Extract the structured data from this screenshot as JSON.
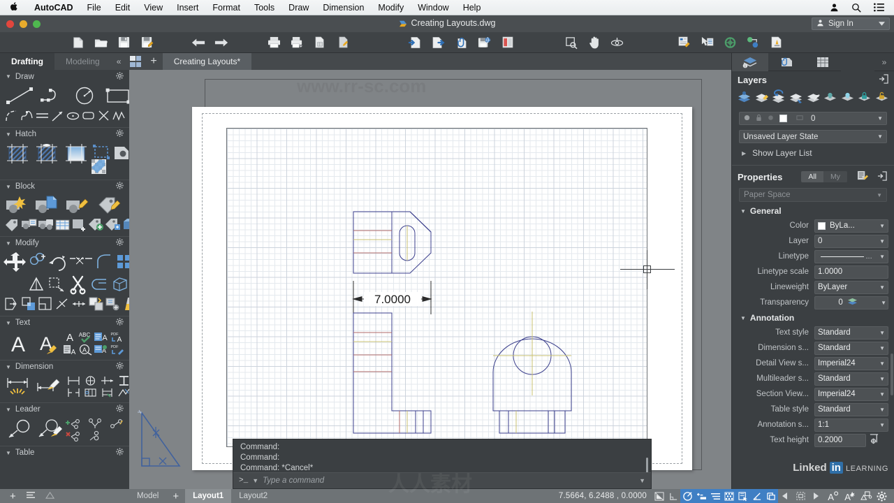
{
  "menubar": {
    "apple_icon": "apple-icon",
    "items": [
      {
        "label": "AutoCAD",
        "bold": true
      },
      {
        "label": "File"
      },
      {
        "label": "Edit"
      },
      {
        "label": "View"
      },
      {
        "label": "Insert"
      },
      {
        "label": "Format"
      },
      {
        "label": "Tools"
      },
      {
        "label": "Draw"
      },
      {
        "label": "Dimension"
      },
      {
        "label": "Modify"
      },
      {
        "label": "Window"
      },
      {
        "label": "Help"
      }
    ],
    "right_icons": [
      "user-icon",
      "search-icon",
      "list-icon"
    ]
  },
  "titlebar": {
    "document_title": "Creating Layouts.dwg",
    "sign_in_label": "Sign In"
  },
  "toolbar": {
    "groups": [
      [
        "new-file-icon",
        "open-folder-icon",
        "save-icon",
        "save-as-icon"
      ],
      [
        "undo-icon",
        "redo-icon"
      ],
      [
        "print-icon",
        "plot-icon",
        "page-setup-icon",
        "plot-preview-icon"
      ],
      [
        "import-icon",
        "export-icon",
        "attach-icon",
        "publish-web-icon",
        "reference-manager-icon"
      ],
      [
        "zoom-window-icon",
        "pan-icon",
        "orbit-icon"
      ],
      [
        "properties-icon",
        "quick-select-icon",
        "measure-icon",
        "point-filter-icon",
        "tool-palette-icon"
      ]
    ]
  },
  "workspace_bar": {
    "tabs": [
      {
        "label": "Drafting",
        "active": true
      },
      {
        "label": "Modeling",
        "active": false
      }
    ],
    "collapse_icon": "chevron-double-left-icon",
    "layout_grid_icon": "layout-grid-icon",
    "new_tab_icon": "plus-icon",
    "document_tab": "Creating Layouts*"
  },
  "left_palette": {
    "groups": [
      {
        "title": "Draw",
        "gear_icon": "gear-icon",
        "tools_row1": [
          "line-icon",
          "polyline-icon",
          "circle-icon",
          "rectangle-icon"
        ],
        "tools_row2": [
          "arc-icon",
          "spline-icon",
          "multiline-icon",
          "ray-icon",
          "ellipse-icon",
          "polygon-icon",
          "construction-line-icon",
          "revision-cloud-icon"
        ]
      },
      {
        "title": "Hatch",
        "gear_icon": "gear-icon",
        "tools_row1": [
          "hatch-icon",
          "hatch-edit-icon",
          "gradient-icon",
          "boundary-icon",
          "wipeout-icon"
        ],
        "tools_row2": [
          "hatch-transparency-icon"
        ]
      },
      {
        "title": "Block",
        "gear_icon": "gear-icon",
        "tools_row1": [
          "insert-block-icon",
          "block-editor-icon",
          "edit-block-icon",
          "define-attribute-icon"
        ],
        "tools_row2": [
          "attribute-icon",
          "block-attributes-icon",
          "sync-attributes-icon",
          "block-table-icon",
          "create-block-icon",
          "block-palette-icon",
          "block-library-icon",
          "base-point-icon"
        ]
      },
      {
        "title": "Modify",
        "gear_icon": "gear-icon",
        "tools_row1": [
          "move-icon",
          "copy-icon",
          "rotate-icon",
          "trim-icon",
          "fillet-icon",
          "array-icon"
        ],
        "tools_row2": [
          "mirror-icon",
          "stretch-icon",
          "scissors-icon",
          "join-icon",
          "3d-solid-icon"
        ],
        "tools_row3": [
          "offset-icon",
          "scale-icon",
          "extend-icon",
          "break-icon",
          "lengthen-icon",
          "explode-icon",
          "edit-polyline-icon",
          "erase-sweep-icon"
        ]
      },
      {
        "title": "Text",
        "gear_icon": "gear-icon",
        "tools_row1": [
          "single-text-icon",
          "text-style-icon",
          "text-edit-icon",
          "spell-check-icon",
          "mtext-icon",
          "pdf-text-icon"
        ],
        "tools_row2": [
          "text-align-icon",
          "find-text-icon",
          "text-scale-icon",
          "pdf-import-icon"
        ]
      },
      {
        "title": "Dimension",
        "gear_icon": "gear-icon",
        "tools_row1": [
          "dimension-icon",
          "dimension-style-icon",
          "baseline-dim-icon",
          "center-mark-icon",
          "continue-dim-icon",
          "tolerance-icon"
        ],
        "tools_row2": [
          "dim-break-icon",
          "dim-inspect-icon",
          "dim-space-icon",
          "dim-jog-icon"
        ]
      },
      {
        "title": "Leader",
        "gear_icon": "gear-icon",
        "tools_row1": [
          "leader-icon",
          "leader-style-icon",
          "add-leader-icon",
          "collect-leader-icon",
          "align-leader-icon"
        ],
        "tools_row2": [
          "remove-leader-icon",
          "leader-merge-icon"
        ]
      },
      {
        "title": "Table",
        "gear_icon": "gear-icon",
        "tools_row1": []
      }
    ]
  },
  "canvas": {
    "drawing": {
      "dimension_label": "7.0000",
      "views": [
        "top-view",
        "front-view",
        "side-view"
      ]
    },
    "crosshair": "crosshair-cursor",
    "command_window": {
      "history": [
        "Command:",
        "Command:",
        "Command: *Cancel*"
      ],
      "prompt": ">_",
      "placeholder": "Type a command"
    }
  },
  "right_palette": {
    "tabs": [
      {
        "icon": "layers-tab-icon",
        "active": true
      },
      {
        "icon": "reference-tab-icon",
        "active": false
      },
      {
        "icon": "sheet-set-tab-icon",
        "active": false
      }
    ],
    "more_icon": "chevron-double-right-icon",
    "layers": {
      "title": "Layers",
      "undock_icon": "undock-icon",
      "tool_icons": [
        "layer-properties-icon",
        "layer-new-icon",
        "layer-previous-icon",
        "layer-match-icon",
        "layer-make-current-icon",
        "layer-off-icon",
        "layer-on-icon",
        "layer-lock-icon",
        "layer-unlock-icon"
      ],
      "current_layer": "0",
      "status_icons": [
        "lightbulb-icon",
        "lock-icon",
        "freeze-icon",
        "color-swatch-icon",
        "plot-icon"
      ],
      "layer_state": "Unsaved Layer State",
      "show_layer_list": "Show Layer List",
      "show_list_tri": "triangle-right-icon"
    },
    "properties": {
      "title": "Properties",
      "filter_all": "All",
      "filter_my": "My",
      "quick_props_icon": "quick-properties-icon",
      "undock_icon": "undock-icon",
      "selection": "Paper Space",
      "sections": [
        {
          "title": "General",
          "rows": [
            {
              "label": "Color",
              "value": "ByLa...",
              "type": "color",
              "swatch": "#ffffff"
            },
            {
              "label": "Layer",
              "value": "0",
              "type": "dropdown"
            },
            {
              "label": "Linetype",
              "value": "",
              "type": "linetype"
            },
            {
              "label": "Linetype scale",
              "value": "1.0000",
              "type": "text"
            },
            {
              "label": "Lineweight",
              "value": "ByLayer",
              "type": "dropdown"
            },
            {
              "label": "Transparency",
              "value": "0",
              "type": "transparency"
            }
          ]
        },
        {
          "title": "Annotation",
          "rows": [
            {
              "label": "Text style",
              "value": "Standard",
              "type": "dropdown"
            },
            {
              "label": "Dimension s...",
              "value": "Standard",
              "type": "dropdown"
            },
            {
              "label": "Detail View s...",
              "value": "Imperial24",
              "type": "dropdown"
            },
            {
              "label": "Multileader s...",
              "value": "Standard",
              "type": "dropdown"
            },
            {
              "label": "Section View...",
              "value": "Imperial24",
              "type": "dropdown"
            },
            {
              "label": "Table style",
              "value": "Standard",
              "type": "dropdown"
            },
            {
              "label": "Annotation s...",
              "value": "1:1",
              "type": "dropdown"
            },
            {
              "label": "Text height",
              "value": "0.2000",
              "type": "text-button"
            }
          ]
        }
      ]
    }
  },
  "bottom_bar": {
    "left_icons": [
      "plus-icon",
      "layer-list-icon",
      "add-layout-icon"
    ],
    "layout_tabs": [
      {
        "label": "Model",
        "active": false
      },
      {
        "label": "Layout1",
        "active": true
      },
      {
        "label": "Layout2",
        "active": false
      }
    ],
    "new_layout_icon": "plus-icon",
    "coordinates": "7.5664, 6.2488 , 0.0000",
    "status_icons": [
      {
        "name": "grid-display-icon",
        "on": false
      },
      {
        "name": "snap-mode-icon",
        "on": false
      },
      {
        "name": "polar-tracking-icon",
        "on": true
      },
      {
        "name": "object-snap-icon",
        "on": true
      },
      {
        "name": "ortho-mode-icon",
        "on": true
      },
      {
        "name": "grid-snap-icon",
        "on": true
      },
      {
        "name": "selection-cycling-icon",
        "on": true
      },
      {
        "name": "angle-constraint-icon",
        "on": true
      },
      {
        "name": "isolate-objects-icon",
        "on": true
      }
    ],
    "viewport_nav": {
      "prev": "triangle-left-icon",
      "label": "viewport-scale-icon",
      "next": "triangle-right-icon"
    },
    "right_icons": [
      "annotation-visibility-icon",
      "auto-scale-icon",
      "annotation-scale-icon",
      "customize-gear-icon"
    ]
  },
  "branding": {
    "linked": "Linked",
    "in": "in",
    "learning": "LEARNING"
  },
  "watermarks": {
    "site": "www.rr-sc.com",
    "cn": "人人素材"
  }
}
